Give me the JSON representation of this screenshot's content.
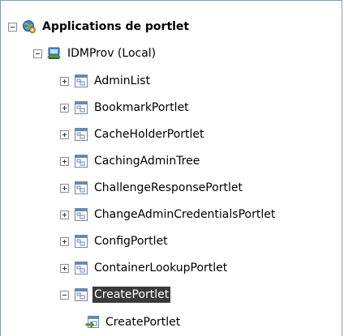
{
  "tree": {
    "root": {
      "label": "Applications de portlet",
      "icon": "globe-gear-icon",
      "state": "expanded"
    },
    "server": {
      "label": "IDMProv (Local)",
      "icon": "server-icon",
      "state": "expanded"
    },
    "portlets": [
      {
        "label": "AdminList",
        "icon": "portlet-window-icon",
        "state": "collapsed"
      },
      {
        "label": "BookmarkPortlet",
        "icon": "portlet-window-icon",
        "state": "collapsed"
      },
      {
        "label": "CacheHolderPortlet",
        "icon": "portlet-window-icon",
        "state": "collapsed"
      },
      {
        "label": "CachingAdminTree",
        "icon": "portlet-window-icon",
        "state": "collapsed"
      },
      {
        "label": "ChallengeResponsePortlet",
        "icon": "portlet-window-icon",
        "state": "collapsed"
      },
      {
        "label": "ChangeAdminCredentialsPortlet",
        "icon": "portlet-window-icon",
        "state": "collapsed"
      },
      {
        "label": "ConfigPortlet",
        "icon": "portlet-window-icon",
        "state": "collapsed"
      },
      {
        "label": "ContainerLookupPortlet",
        "icon": "portlet-window-icon",
        "state": "collapsed"
      },
      {
        "label": "CreatePortlet",
        "icon": "portlet-window-icon",
        "state": "expanded",
        "selected": true
      }
    ],
    "child": {
      "label": "CreatePortlet",
      "icon": "portlet-instance-icon"
    }
  },
  "colors": {
    "selection": "#3a3a3a",
    "border": "#7f9db9",
    "window_icon": "#6b87b3"
  }
}
